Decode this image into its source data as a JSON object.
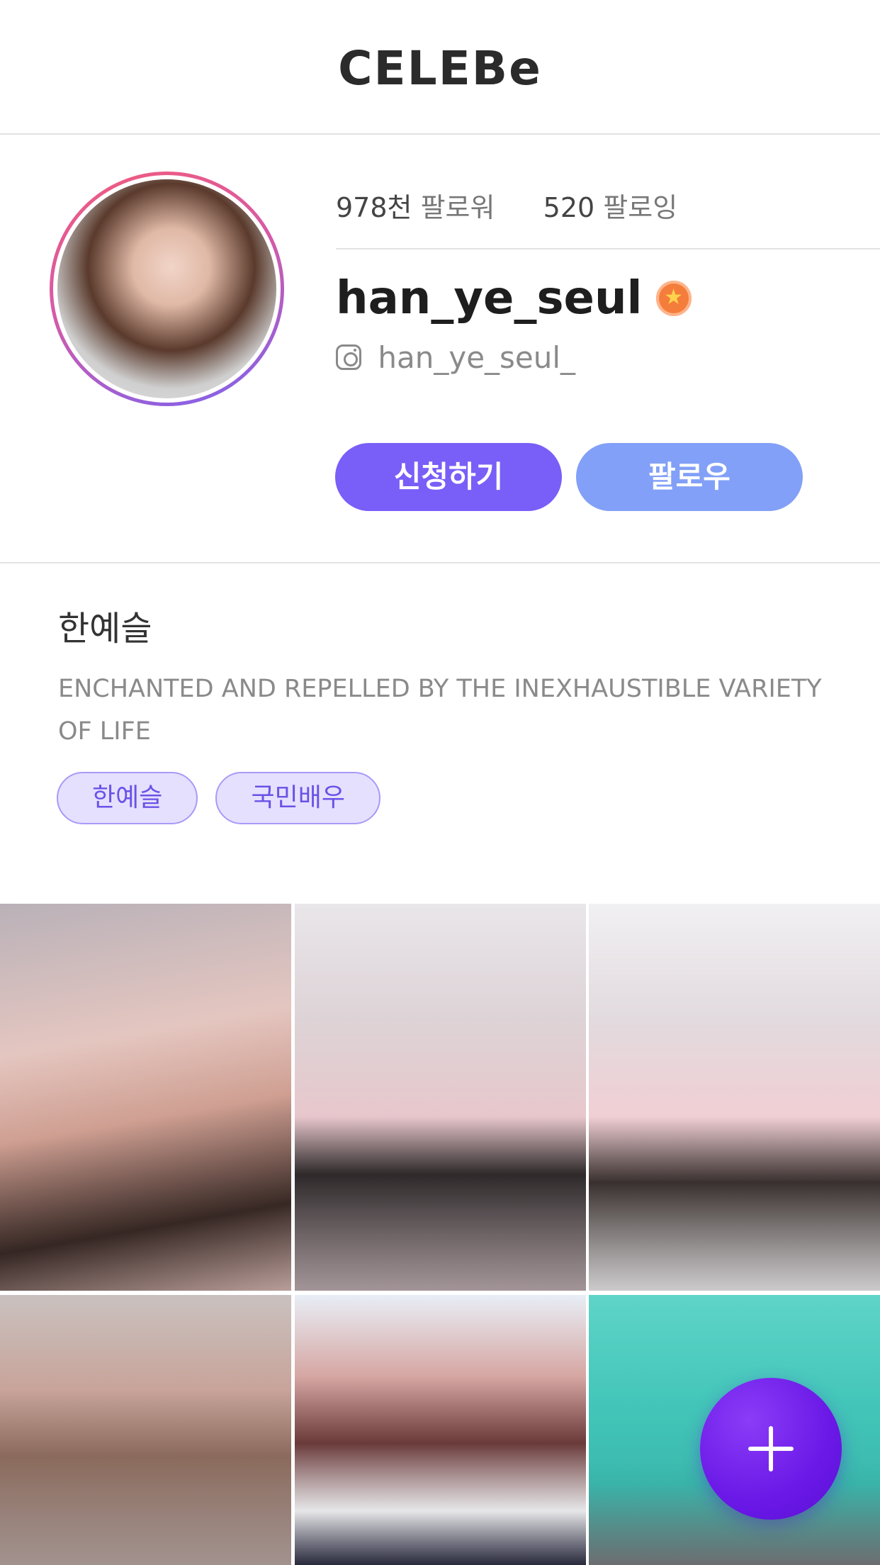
{
  "app": {
    "logo": "CELEBe"
  },
  "profile": {
    "followers_count": "978천",
    "followers_label": "팔로워",
    "following_count": "520",
    "following_label": "팔로잉",
    "username": "han_ye_seul",
    "instagram_handle": "han_ye_seul_",
    "verified_icon": "badge-icon",
    "apply_label": "신청하기",
    "follow_label": "팔로우"
  },
  "bio": {
    "name": "한예슬",
    "text": "ENCHANTED AND REPELLED BY THE INEXHAUSTIBLE VARIETY OF LIFE",
    "tags": [
      "한예슬",
      "국민배우"
    ]
  },
  "grid": {
    "items": 6
  },
  "fab": {
    "icon": "plus-icon"
  },
  "colors": {
    "accent": "#7a5ef8",
    "follow": "#82a0f7",
    "tag_bg": "#e6e0ff",
    "tag_text": "#6a52e6",
    "fab": "#6a18e6"
  }
}
